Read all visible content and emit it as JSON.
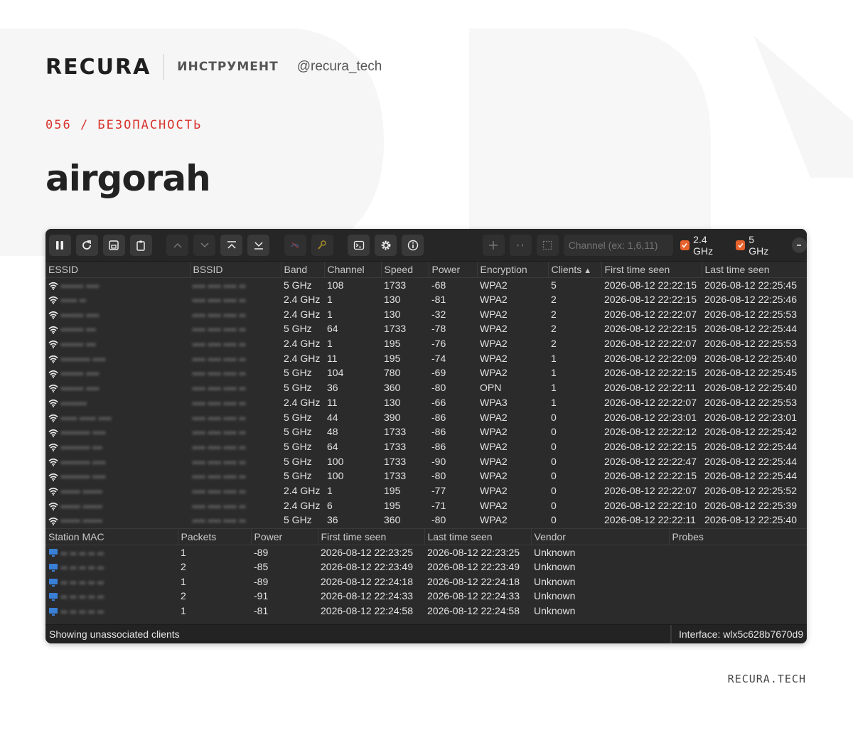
{
  "brand": {
    "logo": "RECURA",
    "tag": "ИНСТРУМЕНТ",
    "handle": "@recura_tech",
    "category": "056 / БЕЗОПАСНОСТЬ",
    "title": "airgorah",
    "footer": "RECURA.TECH"
  },
  "toolbar": {
    "buttons": [
      "pause-icon",
      "refresh-icon",
      "save-icon",
      "clipboard-icon",
      "chevron-up-icon",
      "chevron-down-icon",
      "jump-top-icon",
      "jump-bottom-icon",
      "deauth-icon",
      "decrypt-icon",
      "terminal-icon",
      "gear-icon",
      "info-icon",
      "add-icon",
      "arrows-icon",
      "select-icon"
    ],
    "channel_placeholder": "Channel (ex: 1,6,11)",
    "band_24_label": "2.4 GHz",
    "band_5_label": "5 GHz",
    "accent": "#e8622c"
  },
  "networks": {
    "columns": [
      "ESSID",
      "BSSID",
      "Band",
      "Channel",
      "Speed",
      "Power",
      "Encryption",
      "Clients",
      "First time seen",
      "Last time seen"
    ],
    "sorted_column": "Clients",
    "rows": [
      {
        "essid": "▪▪▪▪▪▪▪ ▪▪▪▪",
        "bssid": "▪▪▪▪ ▪▪▪▪ ▪▪▪▪ ▪▪",
        "band": "5 GHz",
        "channel": "108",
        "speed": "1733",
        "power": "-68",
        "encryption": "WPA2",
        "clients": "5",
        "first": "2026-08-12 22:22:15",
        "last": "2026-08-12 22:25:45"
      },
      {
        "essid": "▪▪▪▪▪ ▪▪",
        "bssid": "▪▪▪▪ ▪▪▪▪ ▪▪▪▪ ▪▪",
        "band": "2.4 GHz",
        "channel": "1",
        "speed": "130",
        "power": "-81",
        "encryption": "WPA2",
        "clients": "2",
        "first": "2026-08-12 22:22:15",
        "last": "2026-08-12 22:25:46"
      },
      {
        "essid": "▪▪▪▪▪▪▪ ▪▪▪▪",
        "bssid": "▪▪▪▪ ▪▪▪▪ ▪▪▪▪ ▪▪",
        "band": "2.4 GHz",
        "channel": "1",
        "speed": "130",
        "power": "-32",
        "encryption": "WPA2",
        "clients": "2",
        "first": "2026-08-12 22:22:07",
        "last": "2026-08-12 22:25:53"
      },
      {
        "essid": "▪▪▪▪▪▪▪ ▪▪▪",
        "bssid": "▪▪▪▪ ▪▪▪▪ ▪▪▪▪ ▪▪",
        "band": "5 GHz",
        "channel": "64",
        "speed": "1733",
        "power": "-78",
        "encryption": "WPA2",
        "clients": "2",
        "first": "2026-08-12 22:22:15",
        "last": "2026-08-12 22:25:44"
      },
      {
        "essid": "▪▪▪▪▪▪▪ ▪▪▪",
        "bssid": "▪▪▪▪ ▪▪▪▪ ▪▪▪▪ ▪▪",
        "band": "2.4 GHz",
        "channel": "1",
        "speed": "195",
        "power": "-76",
        "encryption": "WPA2",
        "clients": "2",
        "first": "2026-08-12 22:22:07",
        "last": "2026-08-12 22:25:53"
      },
      {
        "essid": "▪▪▪▪▪▪▪▪▪ ▪▪▪▪",
        "bssid": "▪▪▪▪ ▪▪▪▪ ▪▪▪▪ ▪▪",
        "band": "2.4 GHz",
        "channel": "11",
        "speed": "195",
        "power": "-74",
        "encryption": "WPA2",
        "clients": "1",
        "first": "2026-08-12 22:22:09",
        "last": "2026-08-12 22:25:40"
      },
      {
        "essid": "▪▪▪▪▪▪▪ ▪▪▪▪",
        "bssid": "▪▪▪▪ ▪▪▪▪ ▪▪▪▪ ▪▪",
        "band": "5 GHz",
        "channel": "104",
        "speed": "780",
        "power": "-69",
        "encryption": "WPA2",
        "clients": "1",
        "first": "2026-08-12 22:22:15",
        "last": "2026-08-12 22:25:45"
      },
      {
        "essid": "▪▪▪▪▪▪▪ ▪▪▪▪",
        "bssid": "▪▪▪▪ ▪▪▪▪ ▪▪▪▪ ▪▪",
        "band": "5 GHz",
        "channel": "36",
        "speed": "360",
        "power": "-80",
        "encryption": "OPN",
        "clients": "1",
        "first": "2026-08-12 22:22:11",
        "last": "2026-08-12 22:25:40"
      },
      {
        "essid": "▪▪▪▪▪▪▪▪",
        "bssid": "▪▪▪▪ ▪▪▪▪ ▪▪▪▪ ▪▪",
        "band": "2.4 GHz",
        "channel": "11",
        "speed": "130",
        "power": "-66",
        "encryption": "WPA3",
        "clients": "1",
        "first": "2026-08-12 22:22:07",
        "last": "2026-08-12 22:25:53"
      },
      {
        "essid": "▪▪▪▪▪ ▪▪▪▪▪ ▪▪▪▪",
        "bssid": "▪▪▪▪ ▪▪▪▪ ▪▪▪▪ ▪▪",
        "band": "5 GHz",
        "channel": "44",
        "speed": "390",
        "power": "-86",
        "encryption": "WPA2",
        "clients": "0",
        "first": "2026-08-12 22:23:01",
        "last": "2026-08-12 22:23:01"
      },
      {
        "essid": "▪▪▪▪▪▪▪▪▪ ▪▪▪▪",
        "bssid": "▪▪▪▪ ▪▪▪▪ ▪▪▪▪ ▪▪",
        "band": "5 GHz",
        "channel": "48",
        "speed": "1733",
        "power": "-86",
        "encryption": "WPA2",
        "clients": "0",
        "first": "2026-08-12 22:22:12",
        "last": "2026-08-12 22:25:42"
      },
      {
        "essid": "▪▪▪▪▪▪▪▪▪ ▪▪▪",
        "bssid": "▪▪▪▪ ▪▪▪▪ ▪▪▪▪ ▪▪",
        "band": "5 GHz",
        "channel": "64",
        "speed": "1733",
        "power": "-86",
        "encryption": "WPA2",
        "clients": "0",
        "first": "2026-08-12 22:22:15",
        "last": "2026-08-12 22:25:44"
      },
      {
        "essid": "▪▪▪▪▪▪▪▪▪ ▪▪▪▪",
        "bssid": "▪▪▪▪ ▪▪▪▪ ▪▪▪▪ ▪▪",
        "band": "5 GHz",
        "channel": "100",
        "speed": "1733",
        "power": "-90",
        "encryption": "WPA2",
        "clients": "0",
        "first": "2026-08-12 22:22:47",
        "last": "2026-08-12 22:25:44"
      },
      {
        "essid": "▪▪▪▪▪▪▪▪▪ ▪▪▪▪",
        "bssid": "▪▪▪▪ ▪▪▪▪ ▪▪▪▪ ▪▪",
        "band": "5 GHz",
        "channel": "100",
        "speed": "1733",
        "power": "-80",
        "encryption": "WPA2",
        "clients": "0",
        "first": "2026-08-12 22:22:15",
        "last": "2026-08-12 22:25:44"
      },
      {
        "essid": "▪▪▪▪▪▪ ▪▪▪▪▪▪",
        "bssid": "▪▪▪▪ ▪▪▪▪ ▪▪▪▪ ▪▪",
        "band": "2.4 GHz",
        "channel": "1",
        "speed": "195",
        "power": "-77",
        "encryption": "WPA2",
        "clients": "0",
        "first": "2026-08-12 22:22:07",
        "last": "2026-08-12 22:25:52"
      },
      {
        "essid": "▪▪▪▪▪▪ ▪▪▪▪▪▪",
        "bssid": "▪▪▪▪ ▪▪▪▪ ▪▪▪▪ ▪▪",
        "band": "2.4 GHz",
        "channel": "6",
        "speed": "195",
        "power": "-71",
        "encryption": "WPA2",
        "clients": "0",
        "first": "2026-08-12 22:22:10",
        "last": "2026-08-12 22:25:39"
      },
      {
        "essid": "▪▪▪▪▪▪ ▪▪▪▪▪▪",
        "bssid": "▪▪▪▪ ▪▪▪▪ ▪▪▪▪ ▪▪",
        "band": "5 GHz",
        "channel": "36",
        "speed": "360",
        "power": "-80",
        "encryption": "WPA2",
        "clients": "0",
        "first": "2026-08-12 22:22:11",
        "last": "2026-08-12 22:25:40"
      }
    ]
  },
  "stations": {
    "columns": [
      "Station MAC",
      "Packets",
      "Power",
      "First time seen",
      "Last time seen",
      "Vendor",
      "Probes"
    ],
    "rows": [
      {
        "mac": "▪▪ ▪▪ ▪▪ ▪▪ ▪▪",
        "packets": "1",
        "power": "-89",
        "first": "2026-08-12 22:23:25",
        "last": "2026-08-12 22:23:25",
        "vendor": "Unknown",
        "probes": ""
      },
      {
        "mac": "▪▪ ▪▪ ▪▪ ▪▪ ▪▪",
        "packets": "2",
        "power": "-85",
        "first": "2026-08-12 22:23:49",
        "last": "2026-08-12 22:23:49",
        "vendor": "Unknown",
        "probes": ""
      },
      {
        "mac": "▪▪ ▪▪ ▪▪ ▪▪ ▪▪",
        "packets": "1",
        "power": "-89",
        "first": "2026-08-12 22:24:18",
        "last": "2026-08-12 22:24:18",
        "vendor": "Unknown",
        "probes": ""
      },
      {
        "mac": "▪▪ ▪▪ ▪▪ ▪▪ ▪▪",
        "packets": "2",
        "power": "-91",
        "first": "2026-08-12 22:24:33",
        "last": "2026-08-12 22:24:33",
        "vendor": "Unknown",
        "probes": ""
      },
      {
        "mac": "▪▪ ▪▪ ▪▪ ▪▪ ▪▪",
        "packets": "1",
        "power": "-81",
        "first": "2026-08-12 22:24:58",
        "last": "2026-08-12 22:24:58",
        "vendor": "Unknown",
        "probes": ""
      }
    ]
  },
  "statusbar": {
    "left": "Showing unassociated clients",
    "right": "Interface: wlx5c628b7670d9"
  }
}
